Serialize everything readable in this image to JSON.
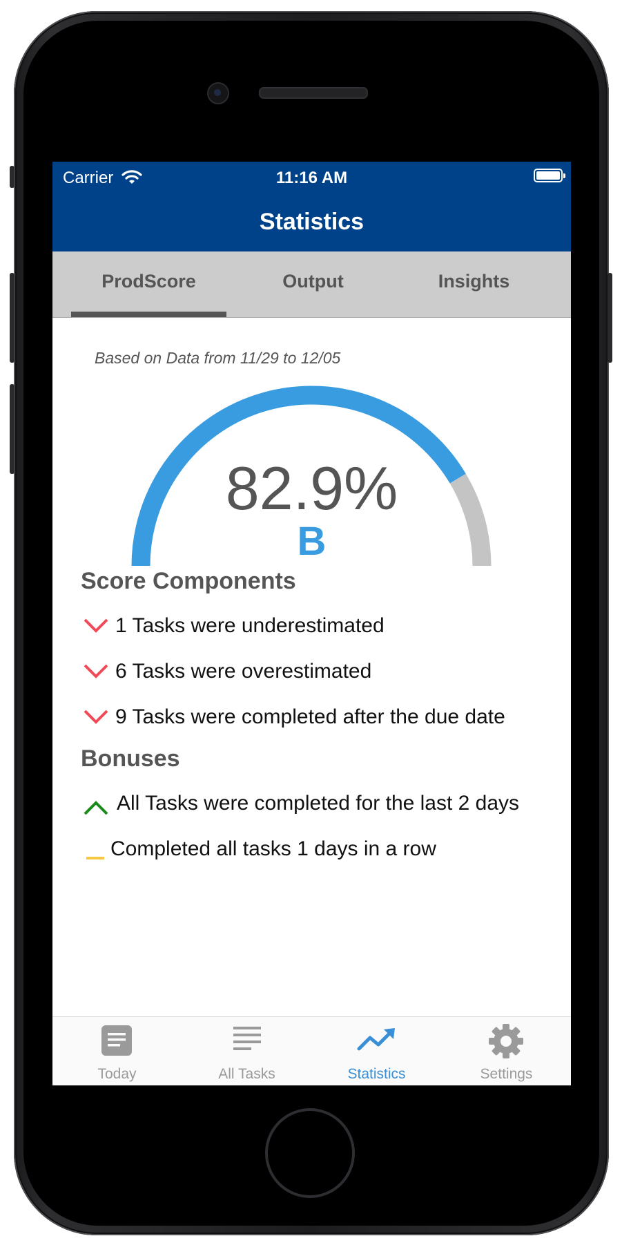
{
  "status_bar": {
    "carrier": "Carrier",
    "time": "11:16 AM"
  },
  "nav": {
    "title": "Statistics"
  },
  "top_tabs": [
    {
      "label": "ProdScore",
      "selected": true
    },
    {
      "label": "Output",
      "selected": false
    },
    {
      "label": "Insights",
      "selected": false
    }
  ],
  "prodscore": {
    "based_on": "Based on Data from 11/29 to 12/05",
    "score_text": "82.9%",
    "score_value": 0.829,
    "grade": "B",
    "gauge_colors": {
      "fill": "#3a9ce0",
      "track": "#c4c4c4"
    }
  },
  "score_components": {
    "heading": "Score Components",
    "items": [
      {
        "icon": "chevron-down-icon",
        "color": "#f04a58",
        "text": "1 Tasks were underestimated"
      },
      {
        "icon": "chevron-down-icon",
        "color": "#f04a58",
        "text": "6 Tasks were overestimated"
      },
      {
        "icon": "chevron-down-icon",
        "color": "#f04a58",
        "text": "9 Tasks were completed after the due date"
      }
    ]
  },
  "bonuses": {
    "heading": "Bonuses",
    "items": [
      {
        "icon": "chevron-up-icon",
        "color": "#1a8a1a",
        "text": "All Tasks were completed for the last 2 days"
      },
      {
        "icon": "dash-icon",
        "color": "#f5c842",
        "text": "Completed all tasks 1 days in a row"
      }
    ]
  },
  "bottom_tabs": [
    {
      "label": "Today",
      "icon": "today-icon",
      "selected": false
    },
    {
      "label": "All Tasks",
      "icon": "list-icon",
      "selected": false
    },
    {
      "label": "Statistics",
      "icon": "trend-up-icon",
      "selected": true
    },
    {
      "label": "Settings",
      "icon": "gear-icon",
      "selected": false
    }
  ],
  "colors": {
    "nav_blue": "#004289",
    "accent_blue": "#3a9ce0",
    "tab_gray": "#cccccc"
  }
}
